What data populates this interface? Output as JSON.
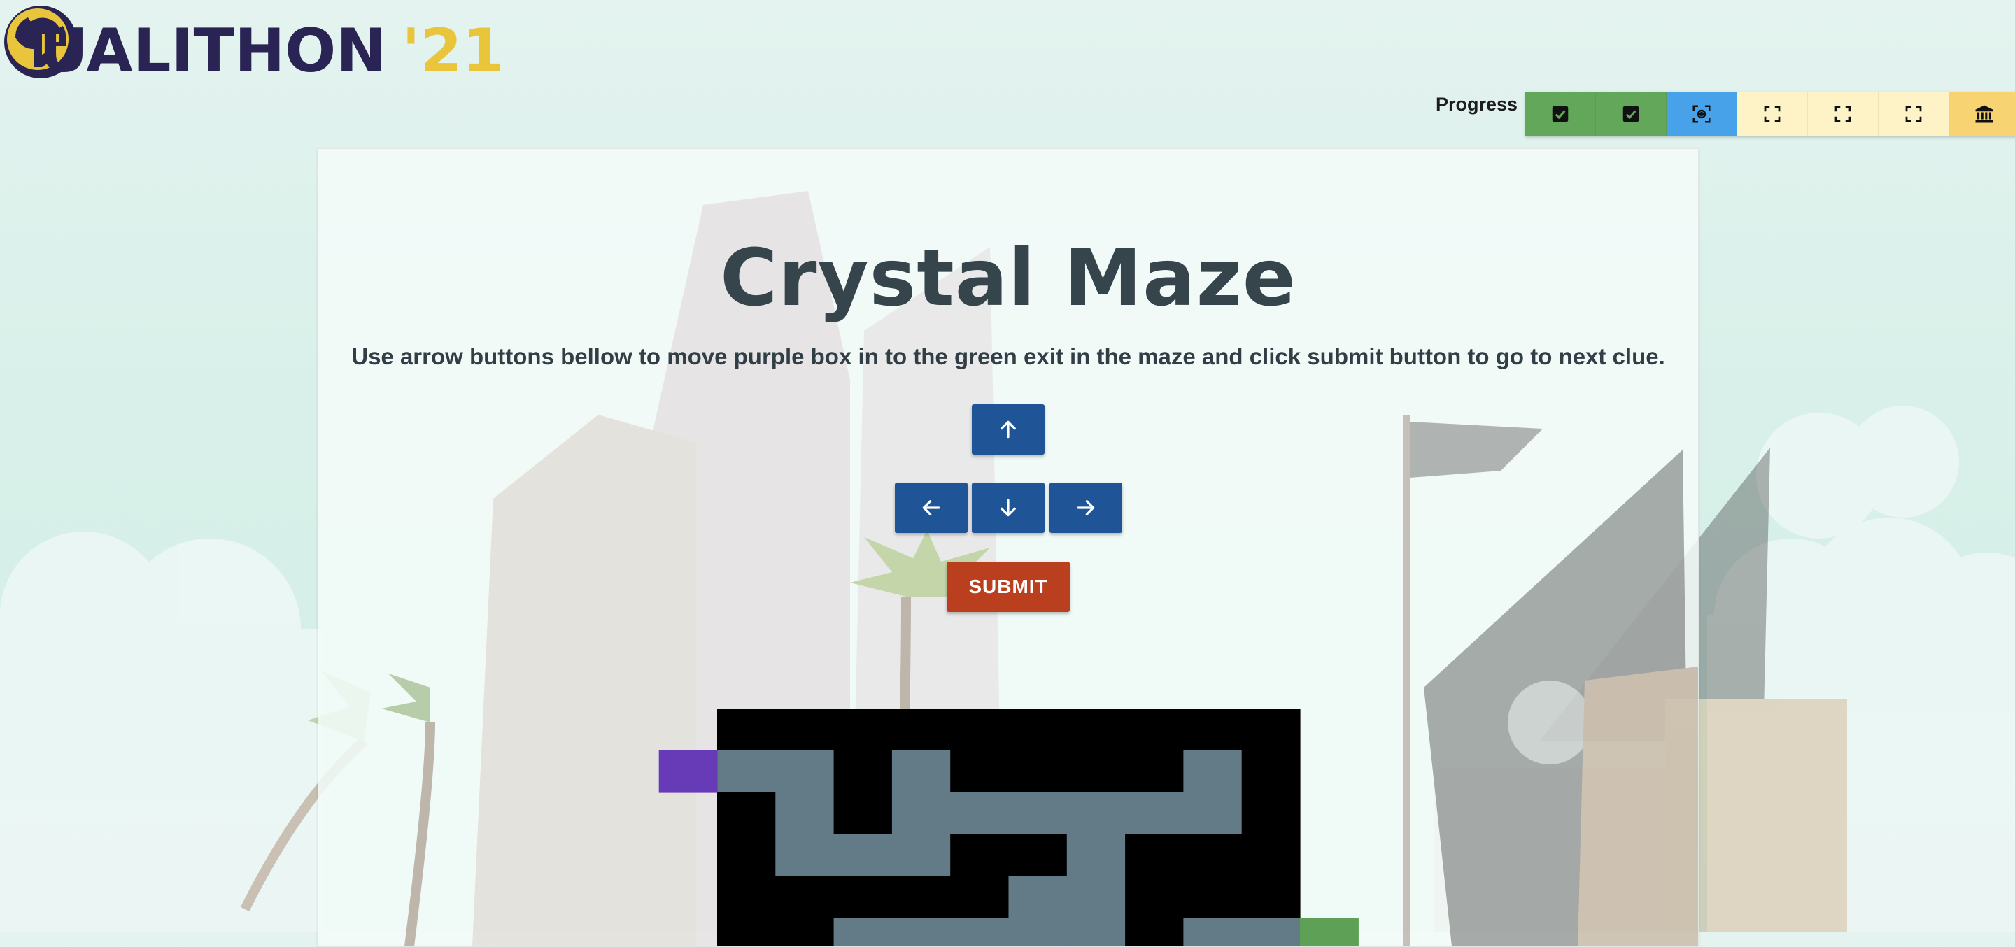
{
  "brand": {
    "name": "UALITHON",
    "year": "'21",
    "colors": {
      "primary": "#2a2454",
      "accent": "#e9c53c"
    }
  },
  "progress": {
    "label": "Progress",
    "steps": [
      {
        "state": "done",
        "icon": "checkbox-checked-icon",
        "color": "#62a75a"
      },
      {
        "state": "done",
        "icon": "checkbox-checked-icon",
        "color": "#62a75a"
      },
      {
        "state": "current",
        "icon": "focus-scan-icon",
        "color": "#48a2e9"
      },
      {
        "state": "locked",
        "icon": "fullscreen-frame-icon",
        "color": "#fdf3c6"
      },
      {
        "state": "locked",
        "icon": "fullscreen-frame-icon",
        "color": "#fdf3c6"
      },
      {
        "state": "locked",
        "icon": "fullscreen-frame-icon",
        "color": "#fdf3c6"
      },
      {
        "state": "final",
        "icon": "bank-icon",
        "color": "#f7d372"
      }
    ]
  },
  "puzzle": {
    "title": "Crystal Maze",
    "instructions": "Use arrow buttons bellow to move purple box in to the green exit in the maze and click submit button to go to next clue.",
    "controls": {
      "up": {
        "icon": "arrow-up-icon"
      },
      "left": {
        "icon": "arrow-left-icon"
      },
      "down": {
        "icon": "arrow-down-icon"
      },
      "right": {
        "icon": "arrow-right-icon"
      }
    },
    "submit_label": "SUBMIT",
    "colors": {
      "button": "#1f5597",
      "submit": "#ba3f1f",
      "wall": "#000000",
      "path": "#637b87",
      "player": "#673ab7",
      "exit": "#5fa057"
    }
  },
  "maze": {
    "grid": [
      "##########",
      "..#.####.#",
      "#.#......#",
      "#...##.###",
      "#####..###",
      "##.....#.."
    ],
    "player": {
      "row": 1,
      "col": -1
    },
    "exit": {
      "row": 5,
      "col": 10
    }
  }
}
